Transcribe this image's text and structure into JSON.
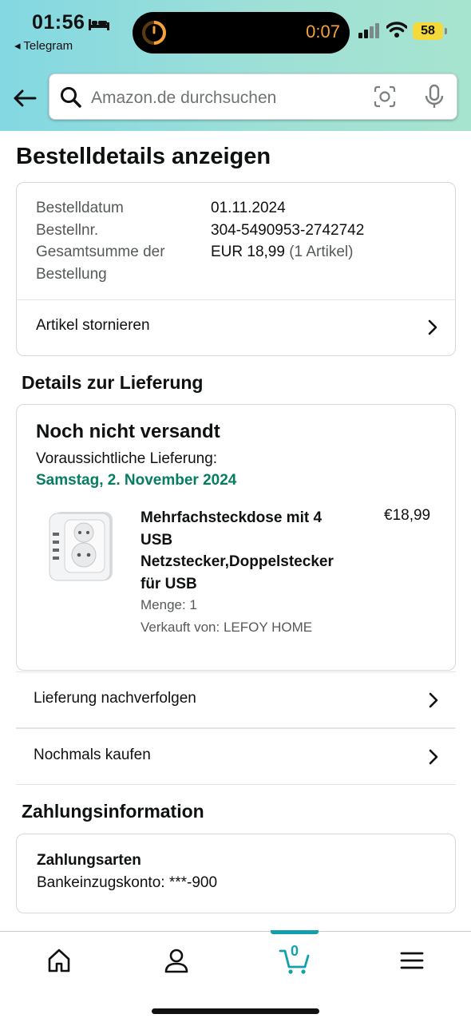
{
  "status_bar": {
    "time": "01:56",
    "back_app": "◂ Telegram",
    "island_time": "0:07",
    "battery": "58"
  },
  "search": {
    "placeholder": "Amazon.de durchsuchen"
  },
  "page_title": "Bestelldetails anzeigen",
  "order_summary": {
    "date_label": "Bestelldatum",
    "date_value": "01.11.2024",
    "number_label": "Bestellnr.",
    "number_value": "304-5490953-2742742",
    "total_label_line1": "Gesamtsumme der",
    "total_label_line2": "Bestellung",
    "total_value": "EUR 18,99",
    "total_items": "(1 Artikel)",
    "cancel_label": "Artikel stornieren"
  },
  "delivery": {
    "section_title": "Details zur Lieferung",
    "status": "Noch nicht versandt",
    "expected_label": "Voraussichtliche Lieferung:",
    "expected_date": "Samstag, 2. November 2024",
    "product": {
      "title": "Mehrfachsteckdose mit 4 USB Netzstecker,Doppelstecker für USB",
      "price": "€18,99",
      "quantity": "Menge: 1",
      "seller": "Verkauft von: LEFOY HOME"
    },
    "track_label": "Lieferung nachverfolgen",
    "buy_again_label": "Nochmals kaufen"
  },
  "payment": {
    "section_title": "Zahlungsinformation",
    "methods_title": "Zahlungsarten",
    "methods_value": "Bankeinzugskonto: ***-900"
  },
  "bottom_nav": {
    "cart_count": "0",
    "items": [
      "home-icon",
      "account-icon",
      "cart-icon",
      "menu-icon"
    ]
  },
  "colors": {
    "accent_teal": "#13a0ae",
    "delivery_green": "#067d62",
    "header_gradient_start": "#83d8e2",
    "header_gradient_end": "#a7e4cf"
  }
}
